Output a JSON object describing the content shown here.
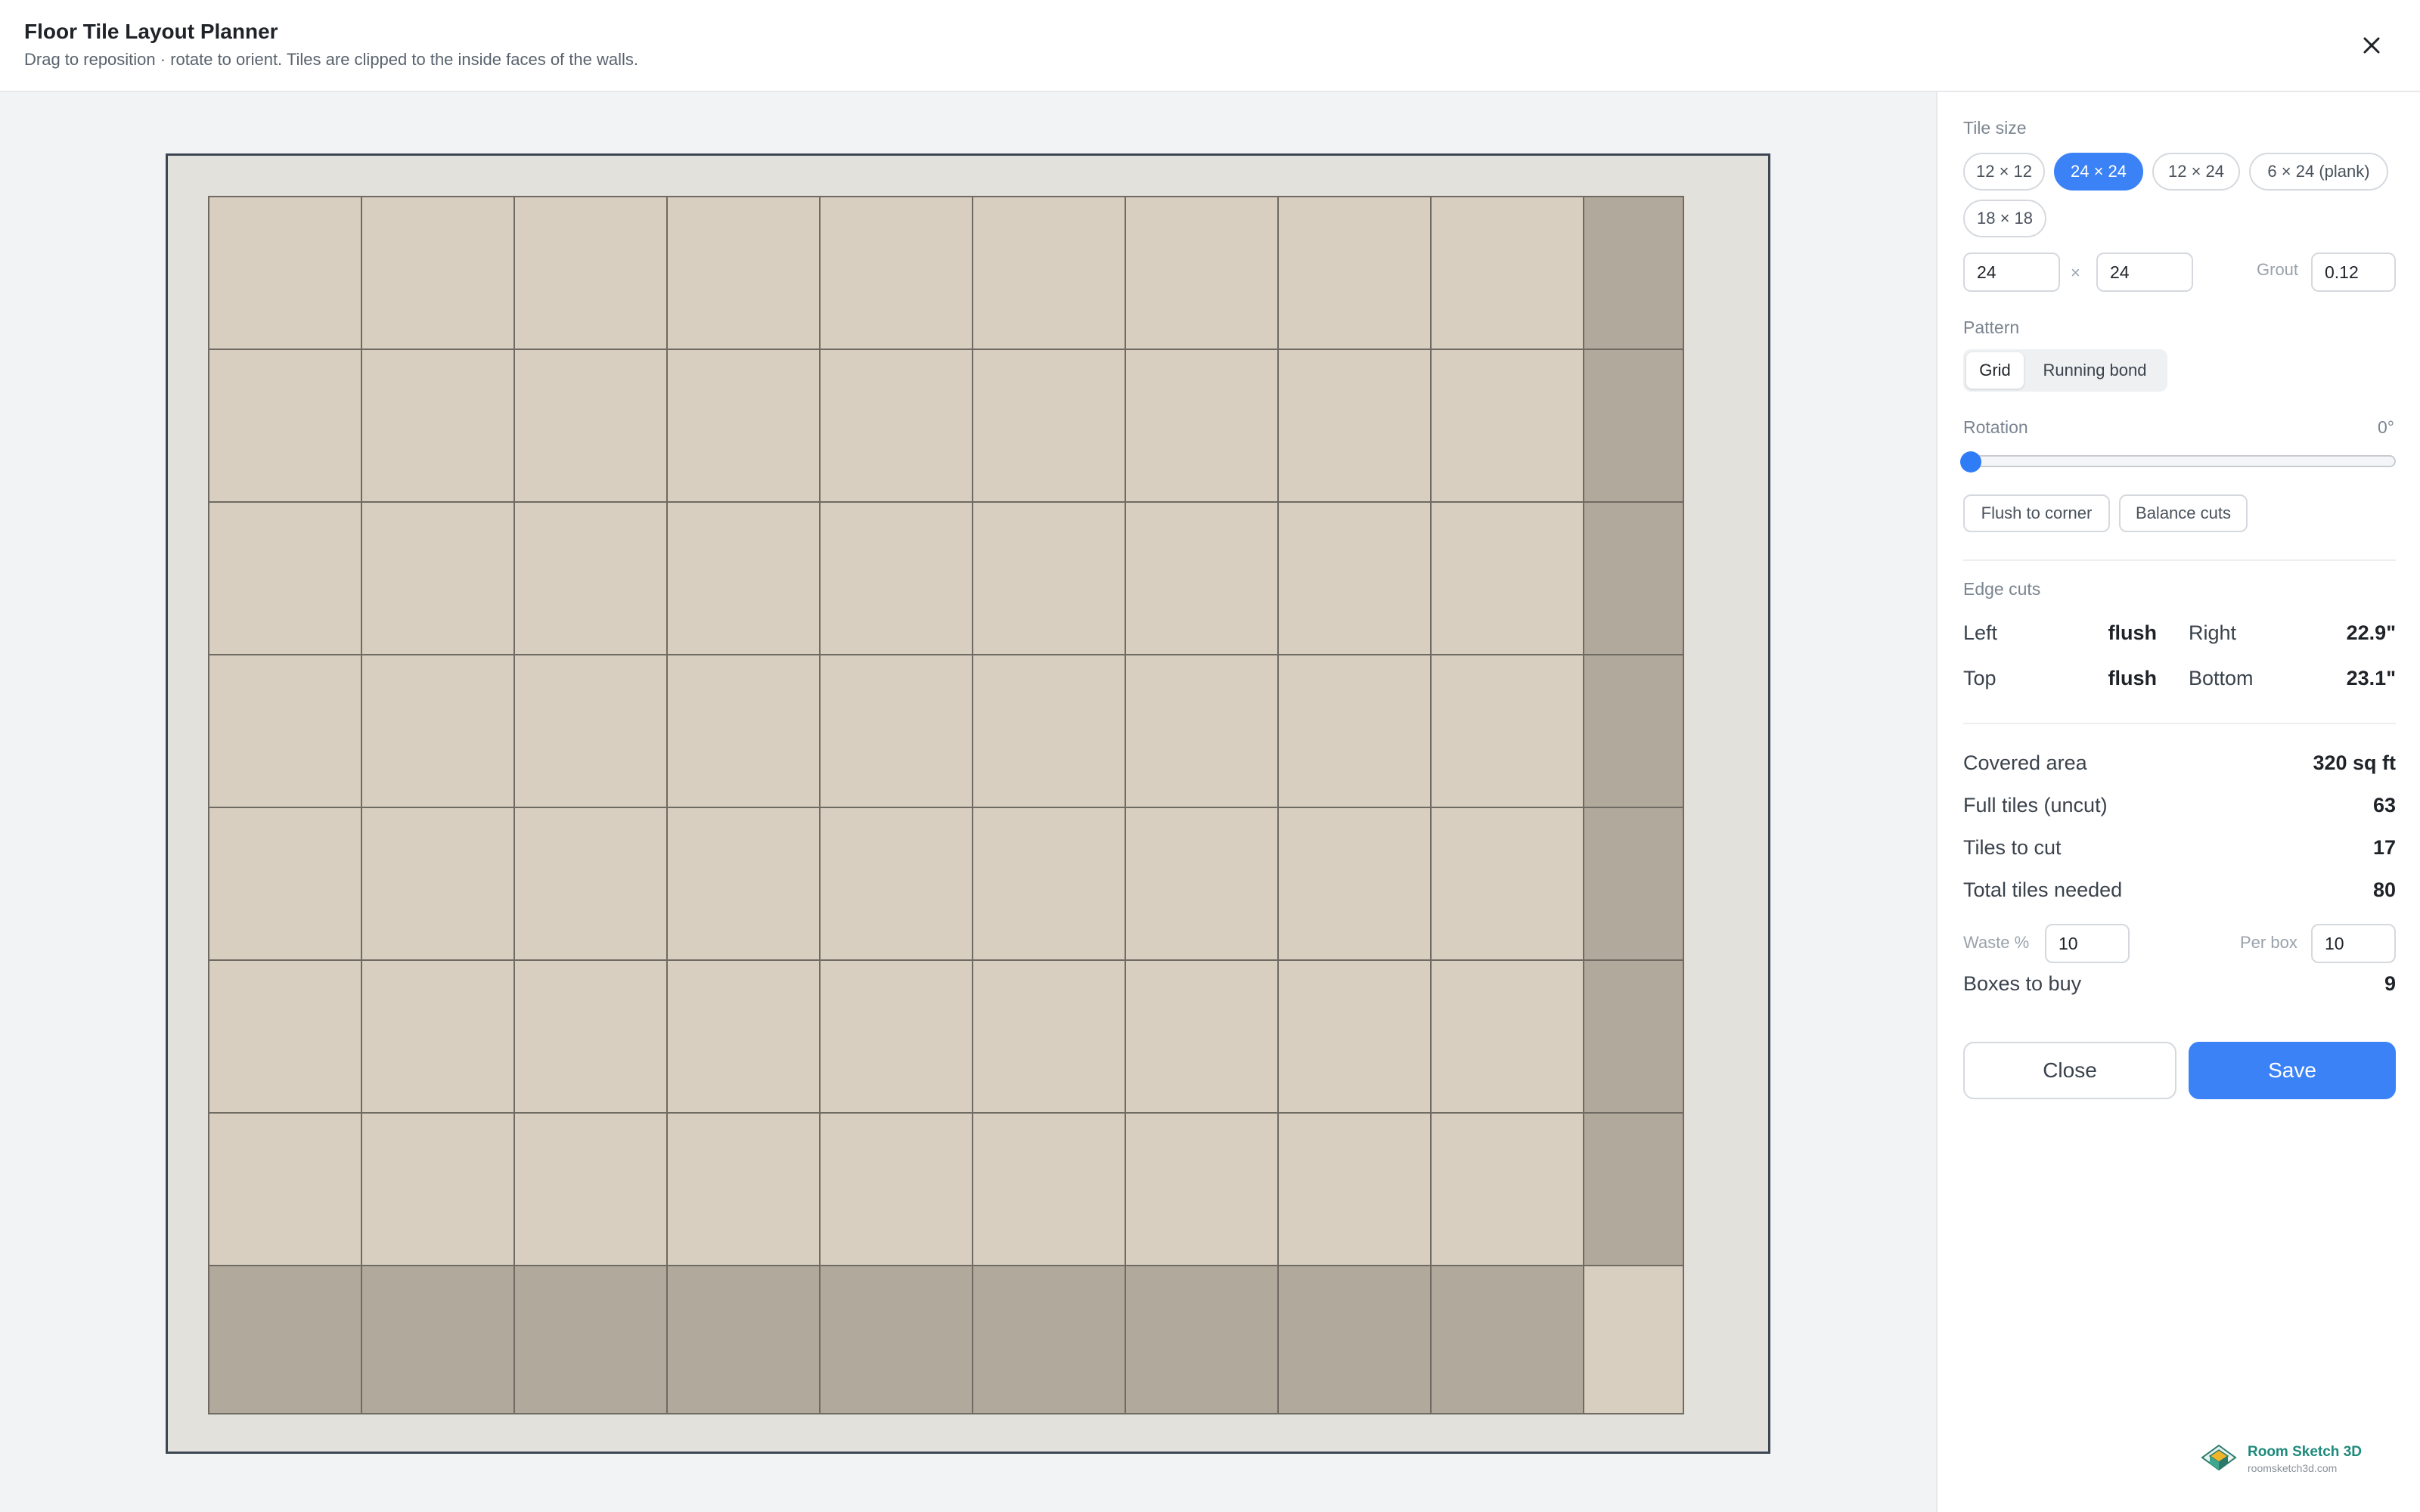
{
  "header": {
    "title": "Floor Tile Layout Planner",
    "subtitle": "Drag to reposition · rotate to orient. Tiles are clipped to the inside faces of the walls.",
    "close_icon": "close-icon"
  },
  "canvas": {
    "grid": {
      "columns": 10,
      "rows": 8,
      "full_color": "#d8cfc1",
      "cut_color": "#b1a99b",
      "grout_color": "#6f6a62",
      "wall_color": "#e3e1dc",
      "wall_border": "#3e4654"
    }
  },
  "sidebar": {
    "tile_size": {
      "label": "Tile size",
      "options": [
        "12 × 12",
        "24 × 24",
        "12 × 24",
        "6 × 24 (plank)",
        "18 × 18"
      ],
      "selected": "24 × 24",
      "width": "24",
      "times": "×",
      "height": "24",
      "grout_label": "Grout",
      "grout": "0.12"
    },
    "pattern": {
      "label": "Pattern",
      "options": [
        "Grid",
        "Running bond"
      ],
      "selected": "Grid"
    },
    "rotation": {
      "label": "Rotation",
      "value": "0°",
      "degrees": 0
    },
    "actions": {
      "flush": "Flush to corner",
      "balance": "Balance cuts"
    },
    "edge_cuts": {
      "label": "Edge cuts",
      "left_label": "Left",
      "left_value": "flush",
      "right_label": "Right",
      "right_value": "22.9\"",
      "top_label": "Top",
      "top_value": "flush",
      "bottom_label": "Bottom",
      "bottom_value": "23.1\""
    },
    "summary": {
      "covered_label": "Covered area",
      "covered_value": "320 sq ft",
      "full_label": "Full tiles (uncut)",
      "full_value": "63",
      "cut_label": "Tiles to cut",
      "cut_value": "17",
      "total_label": "Total tiles needed",
      "total_value": "80",
      "waste_label": "Waste %",
      "waste_value": "10",
      "perbox_label": "Per box",
      "perbox_value": "10",
      "boxes_label": "Boxes to buy",
      "boxes_value": "9"
    },
    "buttons": {
      "close": "Close",
      "save": "Save"
    },
    "brand": {
      "name": "Room Sketch 3D",
      "url": "roomsketch3d.com"
    }
  },
  "colors": {
    "accent": "#3b82f6",
    "brand": "#1d8a7a"
  }
}
